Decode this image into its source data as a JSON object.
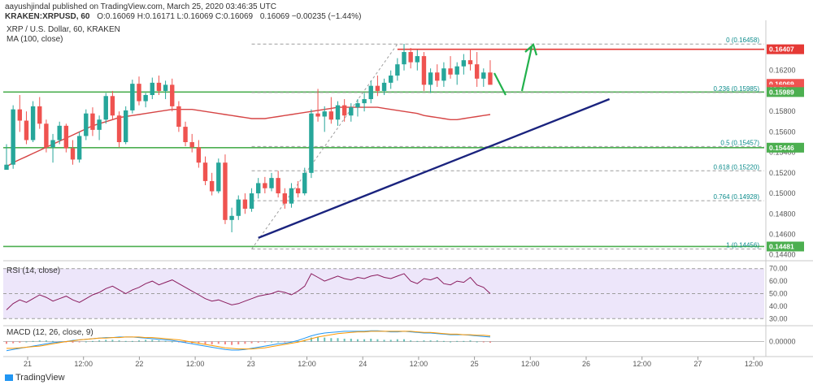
{
  "header": {
    "publisher": "aayushjindal published on TradingView.com, March 25, 2020 03:46:35 UTC",
    "symbol_line": "KRAKEN:XRPUSD, 60",
    "ohlc": "O:0.16069  H:0.16171  L:0.16069  C:0.16069",
    "quote": "0.16069  −0.00235 (−1.44%)"
  },
  "pane_labels": {
    "title": "XRP / U.S. Dollar, 60, KRAKEN",
    "ma": "MA (100, close)",
    "rsi": "RSI (14, close)",
    "macd": "MACD (12, 26, close, 9)"
  },
  "footer": {
    "brand": "TradingView"
  },
  "colors": {
    "up": "#26a69a",
    "down": "#ef5350",
    "ma": "#d64545",
    "support": "#4caf50",
    "resistance": "#e53935",
    "trendline": "#1a237e",
    "arrow": "#22b14c",
    "rsi_band": "#e1d5f7",
    "rsi_line": "#8a1c5e",
    "macd_line": "#2196f3",
    "signal_line": "#ff9800"
  },
  "chart_data": [
    {
      "type": "candlestick",
      "title": "XRP / U.S. Dollar, 60, KRAKEN",
      "ylim": [
        0.1435,
        0.1665
      ],
      "y_ticks": [
        "0.16400",
        "0.16200",
        "0.16000",
        "0.15800",
        "0.15600",
        "0.15400",
        "0.15200",
        "0.15000",
        "0.14800",
        "0.14600",
        "0.14400"
      ],
      "x_ticks": [
        "21",
        "12:00",
        "22",
        "12:00",
        "23",
        "12:00",
        "24",
        "12:00",
        "25",
        "12:00",
        "26",
        "12:00",
        "27",
        "12:00"
      ],
      "price_tags": [
        {
          "label": "0.16407",
          "value": 0.16407,
          "color": "#e53935"
        },
        {
          "label": "0.16069",
          "value": 0.16069,
          "color": "#ef5350"
        },
        {
          "label": "13:30",
          "value": 0.16015,
          "color": "#ef5350"
        },
        {
          "label": "0.15989",
          "value": 0.15989,
          "color": "#4caf50"
        },
        {
          "label": "0.15446",
          "value": 0.15446,
          "color": "#4caf50"
        },
        {
          "label": "0.14481",
          "value": 0.14481,
          "color": "#4caf50"
        }
      ],
      "fib_levels": [
        {
          "label": "0 (0.16458)",
          "value": 0.16458
        },
        {
          "label": "0.236 (0.15985)",
          "value": 0.15985
        },
        {
          "label": "0.5 (0.15457)",
          "value": 0.15457
        },
        {
          "label": "0.618 (0.15220)",
          "value": 0.1522
        },
        {
          "label": "0.764 (0.14928)",
          "value": 0.14928
        },
        {
          "label": "1 (0.14456)",
          "value": 0.14456
        }
      ],
      "horizontal_lines": [
        {
          "value": 0.16407,
          "color": "resistance",
          "from_bar": 59
        },
        {
          "value": 0.15989,
          "color": "support",
          "from_bar": 0
        },
        {
          "value": 0.15446,
          "color": "support",
          "from_bar": 0
        },
        {
          "value": 0.14481,
          "color": "support",
          "from_bar": 0
        }
      ],
      "trendline": {
        "from": [
          38,
          0.14565
        ],
        "to": [
          91,
          0.1592
        ]
      },
      "candles": [
        [
          0.1523,
          0.1548,
          0.1525,
          0.1528
        ],
        [
          0.1528,
          0.1586,
          0.1524,
          0.1582
        ],
        [
          0.1582,
          0.1596,
          0.156,
          0.1571
        ],
        [
          0.1571,
          0.158,
          0.1548,
          0.1552
        ],
        [
          0.1552,
          0.159,
          0.155,
          0.1585
        ],
        [
          0.1585,
          0.1594,
          0.1563,
          0.1568
        ],
        [
          0.1568,
          0.1572,
          0.154,
          0.1545
        ],
        [
          0.1545,
          0.1558,
          0.153,
          0.1552
        ],
        [
          0.1552,
          0.157,
          0.1548,
          0.1566
        ],
        [
          0.1566,
          0.1568,
          0.154,
          0.1544
        ],
        [
          0.1544,
          0.1552,
          0.1528,
          0.1533
        ],
        [
          0.1533,
          0.156,
          0.153,
          0.1556
        ],
        [
          0.1556,
          0.1582,
          0.1552,
          0.1578
        ],
        [
          0.1578,
          0.1584,
          0.1556,
          0.1562
        ],
        [
          0.1562,
          0.1576,
          0.1552,
          0.1572
        ],
        [
          0.1572,
          0.1598,
          0.1568,
          0.1595
        ],
        [
          0.1595,
          0.16,
          0.1572,
          0.1576
        ],
        [
          0.1576,
          0.158,
          0.1545,
          0.155
        ],
        [
          0.155,
          0.1585,
          0.1548,
          0.1581
        ],
        [
          0.1581,
          0.1611,
          0.1578,
          0.1607
        ],
        [
          0.1607,
          0.1614,
          0.1586,
          0.159
        ],
        [
          0.159,
          0.1598,
          0.1584,
          0.1596
        ],
        [
          0.1596,
          0.1613,
          0.1592,
          0.1608
        ],
        [
          0.1608,
          0.1615,
          0.1596,
          0.16
        ],
        [
          0.16,
          0.161,
          0.1592,
          0.1606
        ],
        [
          0.1606,
          0.1612,
          0.158,
          0.1585
        ],
        [
          0.1585,
          0.159,
          0.156,
          0.1565
        ],
        [
          0.1565,
          0.157,
          0.1546,
          0.155
        ],
        [
          0.155,
          0.1558,
          0.154,
          0.1545
        ],
        [
          0.1545,
          0.1552,
          0.1525,
          0.153
        ],
        [
          0.153,
          0.1536,
          0.1508,
          0.1512
        ],
        [
          0.1512,
          0.152,
          0.1498,
          0.1502
        ],
        [
          0.1502,
          0.1534,
          0.15,
          0.153
        ],
        [
          0.153,
          0.1538,
          0.147,
          0.1474
        ],
        [
          0.1474,
          0.1486,
          0.1462,
          0.1478
        ],
        [
          0.1478,
          0.1498,
          0.1474,
          0.1494
        ],
        [
          0.1494,
          0.15,
          0.148,
          0.1485
        ],
        [
          0.1485,
          0.1505,
          0.1482,
          0.15
        ],
        [
          0.15,
          0.1515,
          0.1495,
          0.151
        ],
        [
          0.151,
          0.1516,
          0.15,
          0.1505
        ],
        [
          0.1505,
          0.152,
          0.1502,
          0.1515
        ],
        [
          0.1515,
          0.1522,
          0.1496,
          0.15
        ],
        [
          0.15,
          0.1505,
          0.1485,
          0.149
        ],
        [
          0.149,
          0.151,
          0.1486,
          0.1505
        ],
        [
          0.1505,
          0.1512,
          0.1496,
          0.15
        ],
        [
          0.15,
          0.1525,
          0.1498,
          0.152
        ],
        [
          0.152,
          0.1582,
          0.1515,
          0.1578
        ],
        [
          0.1578,
          0.1602,
          0.157,
          0.1575
        ],
        [
          0.1575,
          0.1585,
          0.156,
          0.158
        ],
        [
          0.158,
          0.1594,
          0.1568,
          0.1572
        ],
        [
          0.1572,
          0.159,
          0.1566,
          0.1586
        ],
        [
          0.1586,
          0.1592,
          0.157,
          0.1576
        ],
        [
          0.1576,
          0.1588,
          0.157,
          0.1584
        ],
        [
          0.1584,
          0.1592,
          0.1575,
          0.1588
        ],
        [
          0.1588,
          0.1598,
          0.158,
          0.1592
        ],
        [
          0.1592,
          0.161,
          0.1588,
          0.1605
        ],
        [
          0.1605,
          0.1615,
          0.1595,
          0.16
        ],
        [
          0.16,
          0.1612,
          0.1596,
          0.1608
        ],
        [
          0.1608,
          0.162,
          0.1602,
          0.1615
        ],
        [
          0.1615,
          0.1632,
          0.161,
          0.1626
        ],
        [
          0.1626,
          0.1646,
          0.162,
          0.1638
        ],
        [
          0.1638,
          0.1642,
          0.1622,
          0.1628
        ],
        [
          0.1628,
          0.164,
          0.162,
          0.1634
        ],
        [
          0.1634,
          0.1638,
          0.16,
          0.1606
        ],
        [
          0.1606,
          0.1622,
          0.1598,
          0.1618
        ],
        [
          0.1618,
          0.1626,
          0.1604,
          0.161
        ],
        [
          0.161,
          0.1628,
          0.1604,
          0.1622
        ],
        [
          0.1622,
          0.1634,
          0.1612,
          0.1616
        ],
        [
          0.1616,
          0.1628,
          0.1606,
          0.1624
        ],
        [
          0.1624,
          0.1636,
          0.1616,
          0.163
        ],
        [
          0.163,
          0.1641,
          0.162,
          0.1626
        ],
        [
          0.1626,
          0.1638,
          0.1604,
          0.1612
        ],
        [
          0.1612,
          0.1622,
          0.1604,
          0.1618
        ],
        [
          0.1618,
          0.163,
          0.161,
          0.1606
        ]
      ],
      "ma_100": [
        0.1526,
        0.153,
        0.1533,
        0.1536,
        0.1539,
        0.1542,
        0.1545,
        0.1548,
        0.1551,
        0.1554,
        0.1557,
        0.156,
        0.1563,
        0.1566,
        0.1568,
        0.157,
        0.1572,
        0.1574,
        0.1575,
        0.1576,
        0.1577,
        0.1578,
        0.1579,
        0.158,
        0.1581,
        0.1582,
        0.1582,
        0.1582,
        0.1582,
        0.1581,
        0.158,
        0.1579,
        0.1578,
        0.1577,
        0.1576,
        0.1575,
        0.1574,
        0.1573,
        0.1573,
        0.1573,
        0.1574,
        0.1575,
        0.1576,
        0.1577,
        0.1578,
        0.1579,
        0.158,
        0.1581,
        0.1582,
        0.1583,
        0.1584,
        0.1584,
        0.1584,
        0.1584,
        0.1584,
        0.1584,
        0.1584,
        0.1583,
        0.1582,
        0.1581,
        0.158,
        0.1579,
        0.1578,
        0.1576,
        0.1575,
        0.1574,
        0.1573,
        0.1572,
        0.1572,
        0.1573,
        0.1574,
        0.1575,
        0.1576,
        0.1577
      ]
    },
    {
      "type": "line",
      "title": "RSI (14, close)",
      "ylim": [
        25,
        75
      ],
      "y_ticks": [
        "70.00",
        "60.00",
        "50.00",
        "40.00",
        "30.00"
      ],
      "band": [
        30,
        70
      ],
      "values": [
        37,
        42,
        45,
        43,
        46,
        49,
        47,
        44,
        46,
        48,
        45,
        43,
        46,
        49,
        51,
        54,
        56,
        53,
        50,
        53,
        55,
        58,
        60,
        57,
        59,
        61,
        58,
        55,
        52,
        49,
        46,
        44,
        45,
        43,
        41,
        42,
        44,
        46,
        48,
        49,
        50,
        52,
        51,
        49,
        52,
        56,
        66,
        63,
        60,
        62,
        64,
        62,
        61,
        63,
        62,
        64,
        65,
        63,
        62,
        64,
        66,
        60,
        58,
        62,
        61,
        63,
        58,
        57,
        60,
        59,
        63,
        57,
        55,
        50
      ]
    },
    {
      "type": "line",
      "title": "MACD (12, 26, close, 9)",
      "ylim": [
        -0.0025,
        0.0025
      ],
      "y_ticks": [
        "0.00000"
      ],
      "histogram": [
        -0.0004,
        -0.0003,
        -0.0002,
        0.0,
        0.0001,
        0.0002,
        0.0002,
        0.0001,
        0.0,
        -0.0001,
        -0.0002,
        -0.0001,
        0.0,
        0.0001,
        0.0002,
        0.0003,
        0.0003,
        0.0002,
        0.0001,
        0.0001,
        0.0002,
        0.0003,
        0.0003,
        0.0002,
        0.0001,
        0.0,
        -0.0001,
        -0.0002,
        -0.0003,
        -0.0004,
        -0.0005,
        -0.0005,
        -0.0004,
        -0.0005,
        -0.0006,
        -0.0005,
        -0.0004,
        -0.0003,
        -0.0002,
        -0.0001,
        0.0,
        0.0,
        -0.0001,
        0.0,
        0.0001,
        0.0003,
        0.0007,
        0.0008,
        0.0007,
        0.0006,
        0.0006,
        0.0005,
        0.0005,
        0.0004,
        0.0004,
        0.0005,
        0.0004,
        0.0003,
        0.0003,
        0.0004,
        0.0004,
        0.0002,
        0.0001,
        0.0002,
        0.0002,
        0.0002,
        0.0001,
        0.0,
        0.0001,
        0.0001,
        0.0002,
        0.0,
        -0.0001,
        -0.0002
      ],
      "macd": [
        -0.0016,
        -0.0014,
        -0.0012,
        -0.001,
        -0.0008,
        -0.0006,
        -0.0004,
        -0.0002,
        -0.0001,
        0.0,
        0.0002,
        0.0003,
        0.0004,
        0.0005,
        0.0006,
        0.0007,
        0.0007,
        0.0008,
        0.0008,
        0.0008,
        0.0007,
        0.0006,
        0.0005,
        0.0004,
        0.0003,
        0.0002,
        0.0,
        -0.0002,
        -0.0004,
        -0.0006,
        -0.0008,
        -0.001,
        -0.0012,
        -0.0014,
        -0.0015,
        -0.0015,
        -0.0014,
        -0.0012,
        -0.001,
        -0.0008,
        -0.0006,
        -0.0004,
        -0.0003,
        -0.0001,
        0.0002,
        0.0006,
        0.001,
        0.0013,
        0.0015,
        0.0016,
        0.0017,
        0.0018,
        0.0018,
        0.0018,
        0.0018,
        0.0019,
        0.0019,
        0.0018,
        0.0017,
        0.0017,
        0.0018,
        0.0017,
        0.0016,
        0.0015,
        0.0015,
        0.0014,
        0.0013,
        0.0012,
        0.0012,
        0.0012,
        0.0011,
        0.001,
        0.0009,
        0.0008
      ],
      "signal": [
        -0.0012,
        -0.0012,
        -0.0011,
        -0.001,
        -0.0009,
        -0.0008,
        -0.0006,
        -0.0004,
        -0.0002,
        0.0,
        0.0001,
        0.0003,
        0.0004,
        0.0005,
        0.0006,
        0.0006,
        0.0007,
        0.0007,
        0.0008,
        0.0008,
        0.0008,
        0.0007,
        0.0007,
        0.0006,
        0.0005,
        0.0004,
        0.0003,
        0.0001,
        -0.0001,
        -0.0003,
        -0.0005,
        -0.0007,
        -0.0009,
        -0.0011,
        -0.0012,
        -0.0013,
        -0.0013,
        -0.0013,
        -0.0012,
        -0.0011,
        -0.0009,
        -0.0007,
        -0.0005,
        -0.0003,
        -0.0001,
        0.0002,
        0.0005,
        0.0008,
        0.001,
        0.0012,
        0.0014,
        0.0015,
        0.0016,
        0.0017,
        0.0017,
        0.0018,
        0.0018,
        0.0018,
        0.0018,
        0.0018,
        0.0018,
        0.0018,
        0.0017,
        0.0016,
        0.0016,
        0.0015,
        0.0014,
        0.0013,
        0.0013,
        0.0012,
        0.0012,
        0.0011,
        0.0011,
        0.001
      ]
    }
  ]
}
